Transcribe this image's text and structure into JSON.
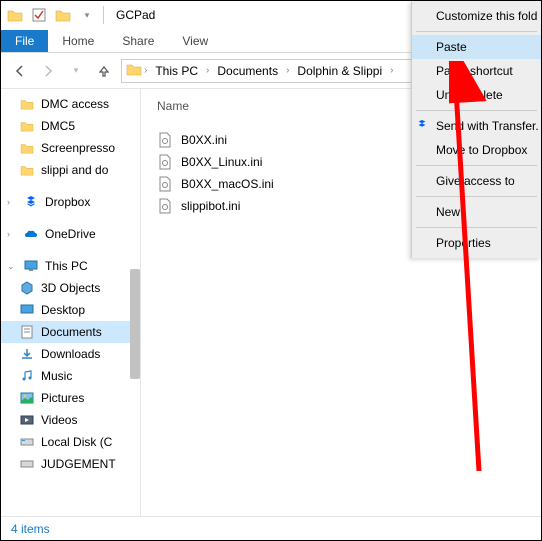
{
  "titlebar": {
    "title": "GCPad"
  },
  "ribbon": {
    "file": "File",
    "tabs": [
      "Home",
      "Share",
      "View"
    ]
  },
  "breadcrumb": [
    "This PC",
    "Documents",
    "Dolphin & Slippi"
  ],
  "columns": {
    "name": "Name"
  },
  "nav": {
    "quick": [
      "DMC access",
      "DMC5",
      "Screenpresso",
      "slippi and do"
    ],
    "dropbox": "Dropbox",
    "onedrive": "OneDrive",
    "thispc": "This PC",
    "pcitems": [
      "3D Objects",
      "Desktop",
      "Documents",
      "Downloads",
      "Music",
      "Pictures",
      "Videos",
      "Local Disk (C",
      "JUDGEMENT"
    ]
  },
  "files": [
    "B0XX.ini",
    "B0XX_Linux.ini",
    "B0XX_macOS.ini",
    "slippibot.ini"
  ],
  "status": "4 items",
  "ctx": {
    "customize": "Customize this fold",
    "paste": "Paste",
    "paste_shortcut": "Paste shortcut",
    "undo": "Undo Delete",
    "send_transfer": "Send with Transfer.",
    "move_dropbox": "Move to Dropbox",
    "give_access": "Give access to",
    "new": "New",
    "properties": "Properties"
  }
}
